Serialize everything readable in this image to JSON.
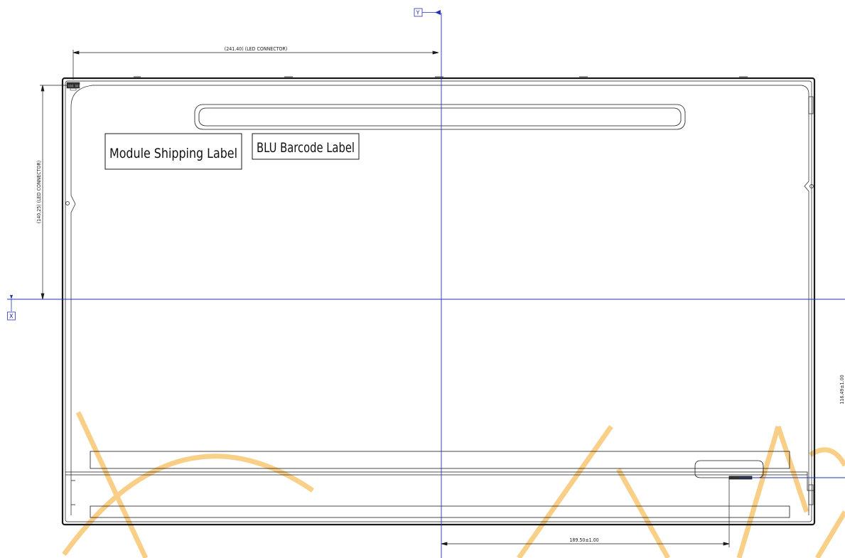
{
  "labels": {
    "module_shipping": "Module Shipping Label",
    "blu_barcode": "BLU Barcode Label"
  },
  "dimensions": {
    "led_connector_horizontal": "(241.40) (LED CONNECTOR)",
    "led_connector_vertical": "(140.25) (LED CONNECTOR)",
    "bottom_offset": "189.50±1.00",
    "right_offset": "116.49±1.00"
  },
  "axes": {
    "x_tag": "X",
    "y_tag": "Y"
  },
  "connector_text": "▯▯▯ ▯▯▯",
  "colors": {
    "line": "#1a1a1a",
    "axis": "#2233bb",
    "watermark": "#f7c060"
  }
}
